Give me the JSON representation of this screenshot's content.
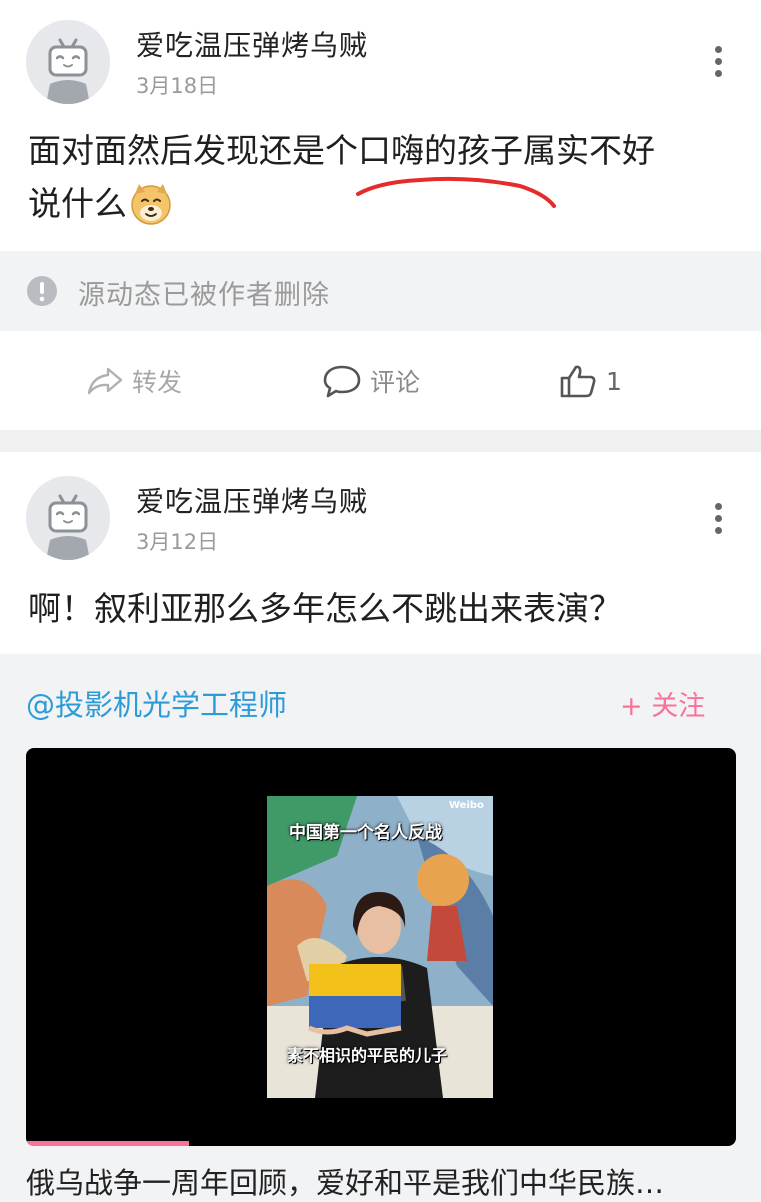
{
  "post1": {
    "username": "爱吃温压弹烤乌贼",
    "date": "3月18日",
    "text_line1": "面对面然后发现还是个口嗨的孩子属实不好",
    "text_line2": "说什么",
    "deleted_notice": "源动态已被作者删除",
    "actions": {
      "repost": "转发",
      "comment": "评论",
      "like_count": "1"
    }
  },
  "post2": {
    "username": "爱吃温压弹烤乌贼",
    "date": "3月12日",
    "text": "啊！叙利亚那么多年怎么不跳出来表演？",
    "original": {
      "author": "@投影机光学工程师",
      "follow_label": "+ 关注",
      "video": {
        "caption_top": "中国第一个名人反战",
        "caption_bottom": "素不相识的平民的儿子",
        "watermark": "Weibo",
        "progress_fraction": 0.23
      },
      "title": "俄乌战争一周年回顾，爱好和平是我们中华民族…"
    }
  },
  "colors": {
    "accent_pink": "#fb7299",
    "link_blue": "#2d9bd8",
    "underline_red": "#e52b2b"
  },
  "icons": [
    "avatar-placeholder-icon",
    "more-icon",
    "info-icon",
    "share-arrow-icon",
    "comment-icon",
    "thumb-up-icon",
    "doge-emoji-icon"
  ]
}
